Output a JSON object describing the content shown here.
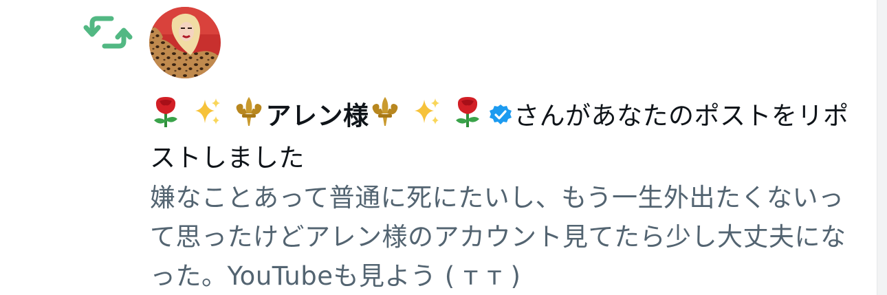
{
  "notification": {
    "type_icon": "retweet-icon",
    "icon_color": "#52b883",
    "avatar": "user-avatar",
    "user": {
      "display_name": "アレン様",
      "name_emojis_before": [
        "rose-emoji",
        "sparkles-emoji",
        "fleur-de-lis-emoji"
      ],
      "name_emojis_after": [
        "fleur-de-lis-emoji",
        "sparkles-emoji",
        "rose-emoji"
      ],
      "verified_icon": "verified-badge-icon",
      "verified_color": "#1d9bf0"
    },
    "action_text": "さんがあなたのポストをリポストしました",
    "post_text": "嫌なことあって普通に死にたいし、もう一生外出たくないって思ったけどアレン様のアカウント見てたら少し大丈夫になった。YouTubeも見よう ( ᴛ ᴛ )"
  },
  "colors": {
    "text_primary": "#0f1419",
    "text_secondary": "#536471",
    "background": "#ffffff"
  }
}
